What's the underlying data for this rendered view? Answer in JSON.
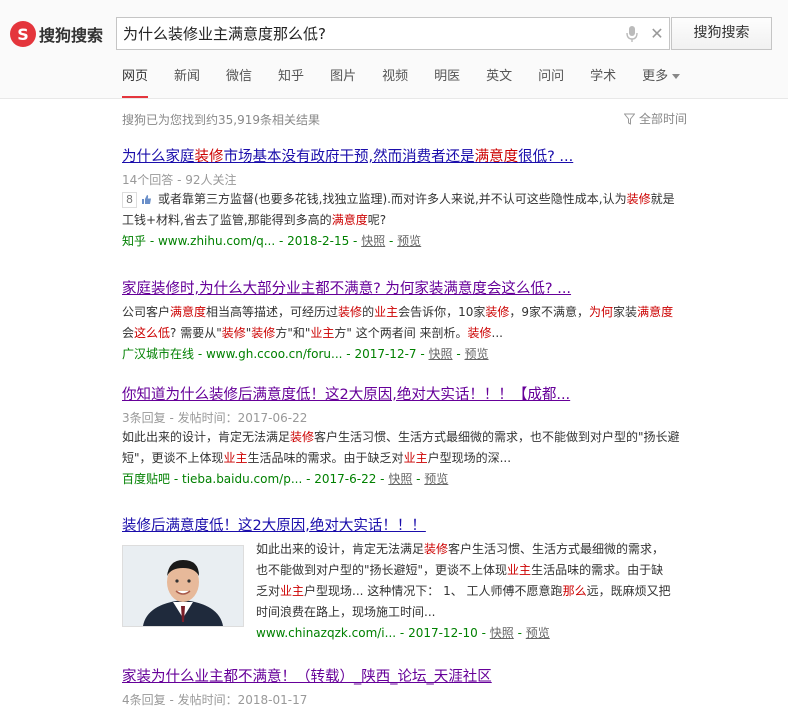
{
  "search": {
    "logo_text": "搜狗搜索",
    "query": "为什么装修业主满意度那么低?",
    "button_label": "搜狗搜索"
  },
  "nav": {
    "tabs": [
      "网页",
      "新闻",
      "微信",
      "知乎",
      "图片",
      "视频",
      "明医",
      "英文",
      "问问",
      "学术"
    ],
    "more_label": "更多"
  },
  "result_count": "搜狗已为您找到约35,919条相关结果",
  "time_filter": "全部时间",
  "results": [
    {
      "title_parts": [
        "为什么",
        "家庭",
        "装修",
        "市场基本没有政府干预,然而消费者还是",
        "满意度",
        "很低? ..."
      ],
      "meta": "14个回答 - 92人关注",
      "badge": "8",
      "snippet_parts": [
        "或者靠第三方监督(也要多花钱,找独立监理).而对许多人来说,并不认可这些隐性成本,认为",
        "装修",
        "就是工钱+材料,省去了监管,那能得到多高的",
        "满意度",
        "呢?"
      ],
      "source": "知乎",
      "url": "www.zhihu.com/q...",
      "date": "2018-2-15",
      "snapshot": "快照",
      "preview": "预览"
    },
    {
      "title_parts": [
        "家庭装修时,为什么大部分业主都不满意? 为何家装满意度会这么低? ..."
      ],
      "snippet_parts": [
        "公司客户",
        "满意度",
        "相当高等描述，可经历过",
        "装修",
        "的",
        "业主",
        "会告诉你，10家",
        "装修",
        "，9家不满意，",
        "为何",
        "家装",
        "满意度",
        "会",
        "这么低",
        "? 需要从\"",
        "装修",
        "\"",
        "装修",
        "方\"和\"",
        "业主",
        "方\" 这个两者间 来剖析。",
        "装修",
        "..."
      ],
      "source": "广汉城市在线",
      "url": "www.gh.ccoo.cn/foru...",
      "date": "2017-12-7",
      "snapshot": "快照",
      "preview": "预览"
    },
    {
      "title_parts": [
        "你知道为什么装修后满意度低！这2大原因,绝对大实话！！！【成都..."
      ],
      "meta": "3条回复 - 发帖时间：2017-06-22",
      "snippet_parts": [
        "如此出来的设计，肯定无法满足",
        "装修",
        "客户生活习惯、生活方式最细微的需求，也不能做到对户型的\"扬长避短\"，更谈不上体现",
        "业主",
        "生活品味的需求。由于缺乏对",
        "业主",
        "户型现场的深..."
      ],
      "source": "百度贴吧",
      "url": "tieba.baidu.com/p...",
      "date": "2017-6-22",
      "snapshot": "快照",
      "preview": "预览"
    },
    {
      "title_parts": [
        "装修后满意度低！这2大原因,绝对大实话！！！"
      ],
      "snippet_parts": [
        "如此出来的设计，肯定无法满足",
        "装修",
        "客户生活习惯、生活方式最细微的需求，也不能做到对户型的\"扬长避短\"，更谈不上体现",
        "业主",
        "生活品味的需求。由于缺乏对",
        "业主",
        "户型现场... 这种情况下： 1、 工人师傅不愿意跑",
        "那么",
        "远，既麻烦又把时间浪费在路上，现场施工时间..."
      ],
      "url": "www.chinazqzk.com/i...",
      "date": "2017-12-10",
      "snapshot": "快照",
      "preview": "预览"
    },
    {
      "title_parts": [
        "家装为什么业主都不满意！（转载）_陕西_论坛_天涯社区"
      ],
      "meta": "4条回复 - 发帖时间：2018-01-17"
    }
  ],
  "colors": {
    "link": "#1a0dab",
    "visited": "#660099",
    "highlight": "#cc0000",
    "url_green": "#008000",
    "logo_red": "#e4353c"
  }
}
